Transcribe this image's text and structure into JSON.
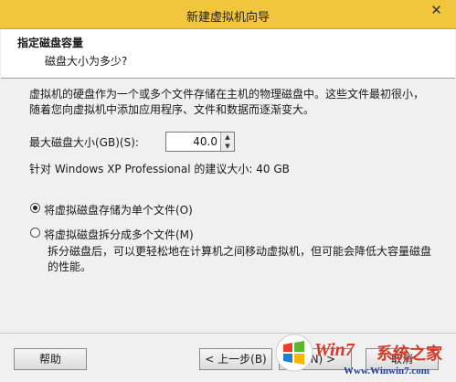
{
  "window": {
    "title": "新建虚拟机向导",
    "close_glyph": "✕"
  },
  "header": {
    "title": "指定磁盘容量",
    "subtitle": "磁盘大小为多少?"
  },
  "description": "虚拟机的硬盘作为一个或多个文件存储在主机的物理磁盘中。这些文件最初很小，随着您向虚拟机中添加应用程序、文件和数据而逐渐变大。",
  "disk_size": {
    "label": "最大磁盘大小(GB)(S):",
    "value": "40.0"
  },
  "recommendation": "针对 Windows XP Professional 的建议大小: 40 GB",
  "options": [
    {
      "label": "将虚拟磁盘存储为单个文件(O)",
      "checked": true
    },
    {
      "label": "将虚拟磁盘拆分成多个文件(M)",
      "checked": false
    }
  ],
  "split_note": "拆分磁盘后，可以更轻松地在计算机之间移动虚拟机，但可能会降低大容量磁盘的性能。",
  "buttons": {
    "help": "帮助",
    "back": "< 上一步(B)",
    "next": "步(N) >",
    "cancel": "取消"
  },
  "watermark": {
    "brand": "Win7",
    "tagline": "系统之家",
    "url": "Www.Winwin7.com"
  }
}
